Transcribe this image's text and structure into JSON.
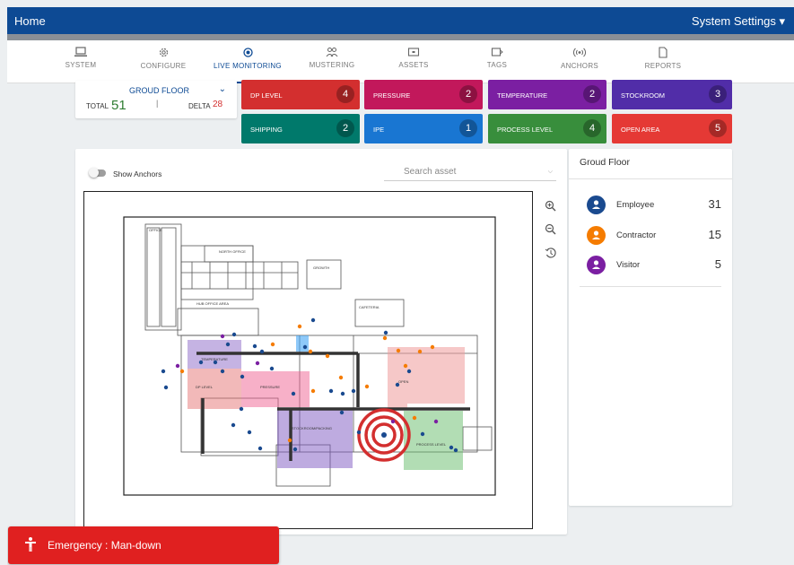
{
  "topbar": {
    "home": "Home",
    "settings": "System Settings ▾"
  },
  "nav": {
    "tabs": [
      {
        "label": "SYSTEM",
        "icon": "laptop-icon"
      },
      {
        "label": "CONFIGURE",
        "icon": "gear-icon"
      },
      {
        "label": "LIVE MONITORING",
        "icon": "location-target-icon",
        "active": true
      },
      {
        "label": "MUSTERING",
        "icon": "group-icon"
      },
      {
        "label": "ASSETS",
        "icon": "asset-box-icon"
      },
      {
        "label": "TAGS",
        "icon": "tag-icon"
      },
      {
        "label": "ANCHORS",
        "icon": "anchor-signal-icon"
      },
      {
        "label": "REPORTS",
        "icon": "document-icon"
      }
    ]
  },
  "floor": {
    "name": "GROUD FLOOR",
    "total_label": "TOTAL",
    "total": "51",
    "separator": "|",
    "delta_label": "DELTA",
    "delta": "28"
  },
  "zones": [
    {
      "label": "DP LEVEL",
      "count": "4",
      "color": "#d32f2f"
    },
    {
      "label": "PRESSURE",
      "count": "2",
      "color": "#c2185b"
    },
    {
      "label": "TEMPERATURE",
      "count": "2",
      "color": "#7b1fa2"
    },
    {
      "label": "STOCKROOM",
      "count": "3",
      "color": "#512da8"
    },
    {
      "label": "SHIPPING",
      "count": "2",
      "color": "#00796b"
    },
    {
      "label": "IPE",
      "count": "1",
      "color": "#1976d2"
    },
    {
      "label": "PROCESS LEVEL",
      "count": "4",
      "color": "#388e3c"
    },
    {
      "label": "OPEN AREA",
      "count": "5",
      "color": "#e53935"
    }
  ],
  "map": {
    "show_anchors_label": "Show Anchors",
    "search_placeholder": "Search asset",
    "plan_labels": {
      "north_office": "NORTH OFFICE",
      "hub_office": "HUB OFFICE AREA",
      "dp_level": "DP LEVEL",
      "pressure": "PRESSURE",
      "temperature": "TEMPERATURE",
      "stockroom": "STOCKROOM/PACKING",
      "open": "OPEN",
      "process_level": "PROCESS LEVEL",
      "office": "OFFICE",
      "growth": "GROWTH",
      "cafeteria": "CAFETERIA"
    }
  },
  "side": {
    "title": "Groud Floor",
    "rows": [
      {
        "label": "Employee",
        "value": "31",
        "color": "#1a4a8f"
      },
      {
        "label": "Contractor",
        "value": "15",
        "color": "#f57c00"
      },
      {
        "label": "Visitor",
        "value": "5",
        "color": "#7b1fa2"
      }
    ]
  },
  "emergency": {
    "text": "Emergency : Man-down"
  }
}
